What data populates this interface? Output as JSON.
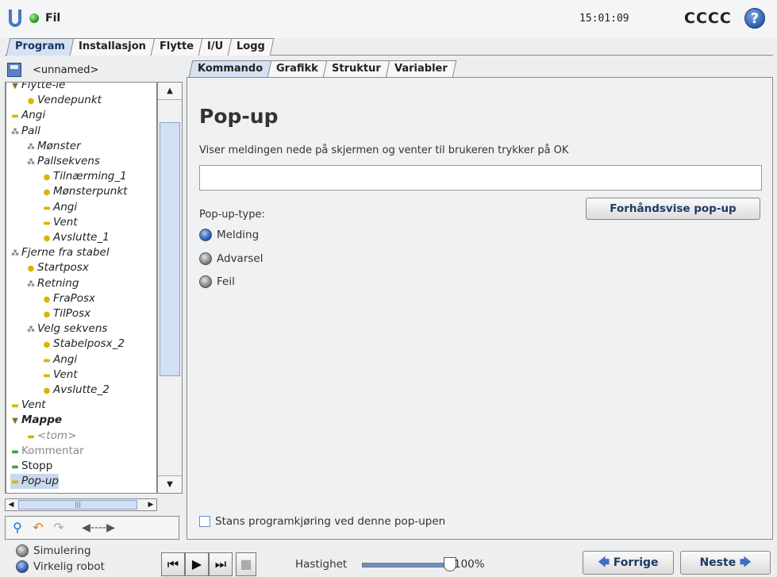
{
  "header": {
    "file_label": "Fil",
    "clock": "15:01:09",
    "robot_name": "CCCC",
    "help": "?"
  },
  "main_tabs": [
    {
      "label": "Program",
      "active": true
    },
    {
      "label": "Installasjon"
    },
    {
      "label": "Flytte"
    },
    {
      "label": "I/U"
    },
    {
      "label": "Logg"
    }
  ],
  "left": {
    "program_name": "<unnamed>"
  },
  "tree": [
    {
      "label": "Flytte-le",
      "icon": "folder-triangle-icon",
      "depth": 0
    },
    {
      "label": "Vendepunkt",
      "icon": "waypoint-icon",
      "depth": 1
    },
    {
      "label": "Angi",
      "icon": "set-icon",
      "depth": 0
    },
    {
      "label": "Pall",
      "icon": "pattern-icon",
      "depth": 0
    },
    {
      "label": "Mønster",
      "icon": "pattern-icon",
      "depth": 1
    },
    {
      "label": "Pallsekvens",
      "icon": "pattern-icon",
      "depth": 1
    },
    {
      "label": "Tilnærming_1",
      "icon": "waypoint-icon",
      "depth": 2
    },
    {
      "label": "Mønsterpunkt",
      "icon": "waypoint-icon",
      "depth": 2
    },
    {
      "label": "Angi",
      "icon": "set-icon",
      "depth": 2
    },
    {
      "label": "Vent",
      "icon": "set-icon",
      "depth": 2
    },
    {
      "label": "Avslutte_1",
      "icon": "waypoint-icon",
      "depth": 2
    },
    {
      "label": "Fjerne fra stabel",
      "icon": "pattern-icon",
      "depth": 0
    },
    {
      "label": "Startposx",
      "icon": "waypoint-icon",
      "depth": 1
    },
    {
      "label": "Retning",
      "icon": "pattern-icon",
      "depth": 1
    },
    {
      "label": "FraPosx",
      "icon": "waypoint-icon",
      "depth": 2
    },
    {
      "label": "TilPosx",
      "icon": "waypoint-icon",
      "depth": 2
    },
    {
      "label": "Velg sekvens",
      "icon": "pattern-icon",
      "depth": 1
    },
    {
      "label": "Stabelposx_2",
      "icon": "waypoint-icon",
      "depth": 2
    },
    {
      "label": "Angi",
      "icon": "set-icon",
      "depth": 2
    },
    {
      "label": "Vent",
      "icon": "set-icon",
      "depth": 2
    },
    {
      "label": "Avslutte_2",
      "icon": "waypoint-icon",
      "depth": 2
    },
    {
      "label": "Vent",
      "icon": "set-icon",
      "depth": 0
    },
    {
      "label": "Mappe",
      "icon": "folder-triangle-icon",
      "depth": 0
    },
    {
      "label": "<tom>",
      "icon": "set-icon",
      "depth": 1
    },
    {
      "label": "Kommentar",
      "icon": "comment-icon",
      "depth": 0
    },
    {
      "label": "Stopp",
      "icon": "stop-icon",
      "depth": 0
    },
    {
      "label": "Pop-up",
      "icon": "popup-icon",
      "depth": 0
    }
  ],
  "sub_tabs": [
    {
      "label": "Kommando",
      "active": true
    },
    {
      "label": "Grafikk"
    },
    {
      "label": "Struktur"
    },
    {
      "label": "Variabler"
    }
  ],
  "content": {
    "title": "Pop-up",
    "description": "Viser meldingen nede på skjermen og venter til brukeren trykker på OK",
    "message_value": "",
    "popup_type_label": "Pop-up-type:",
    "preview_button": "Forhåndsvise pop-up",
    "options": [
      {
        "label": "Melding",
        "selected": true
      },
      {
        "label": "Advarsel",
        "selected": false
      },
      {
        "label": "Feil",
        "selected": false
      }
    ],
    "halt_label": "Stans programkjøring ved denne pop-upen",
    "halt_checked": false
  },
  "bottom": {
    "simulation_label": "Simulering",
    "real_robot_label": "Virkelig robot",
    "speed_label": "Hastighet",
    "speed_value": "100%",
    "speed_fraction": 1.0,
    "prev_button": "Forrige",
    "next_button": "Neste"
  },
  "colors": {
    "accent": "#1b4ea8",
    "tab_active": "#d6e2f3",
    "selection": "#c9d8ef",
    "status_ok": "#1f8c1b"
  }
}
